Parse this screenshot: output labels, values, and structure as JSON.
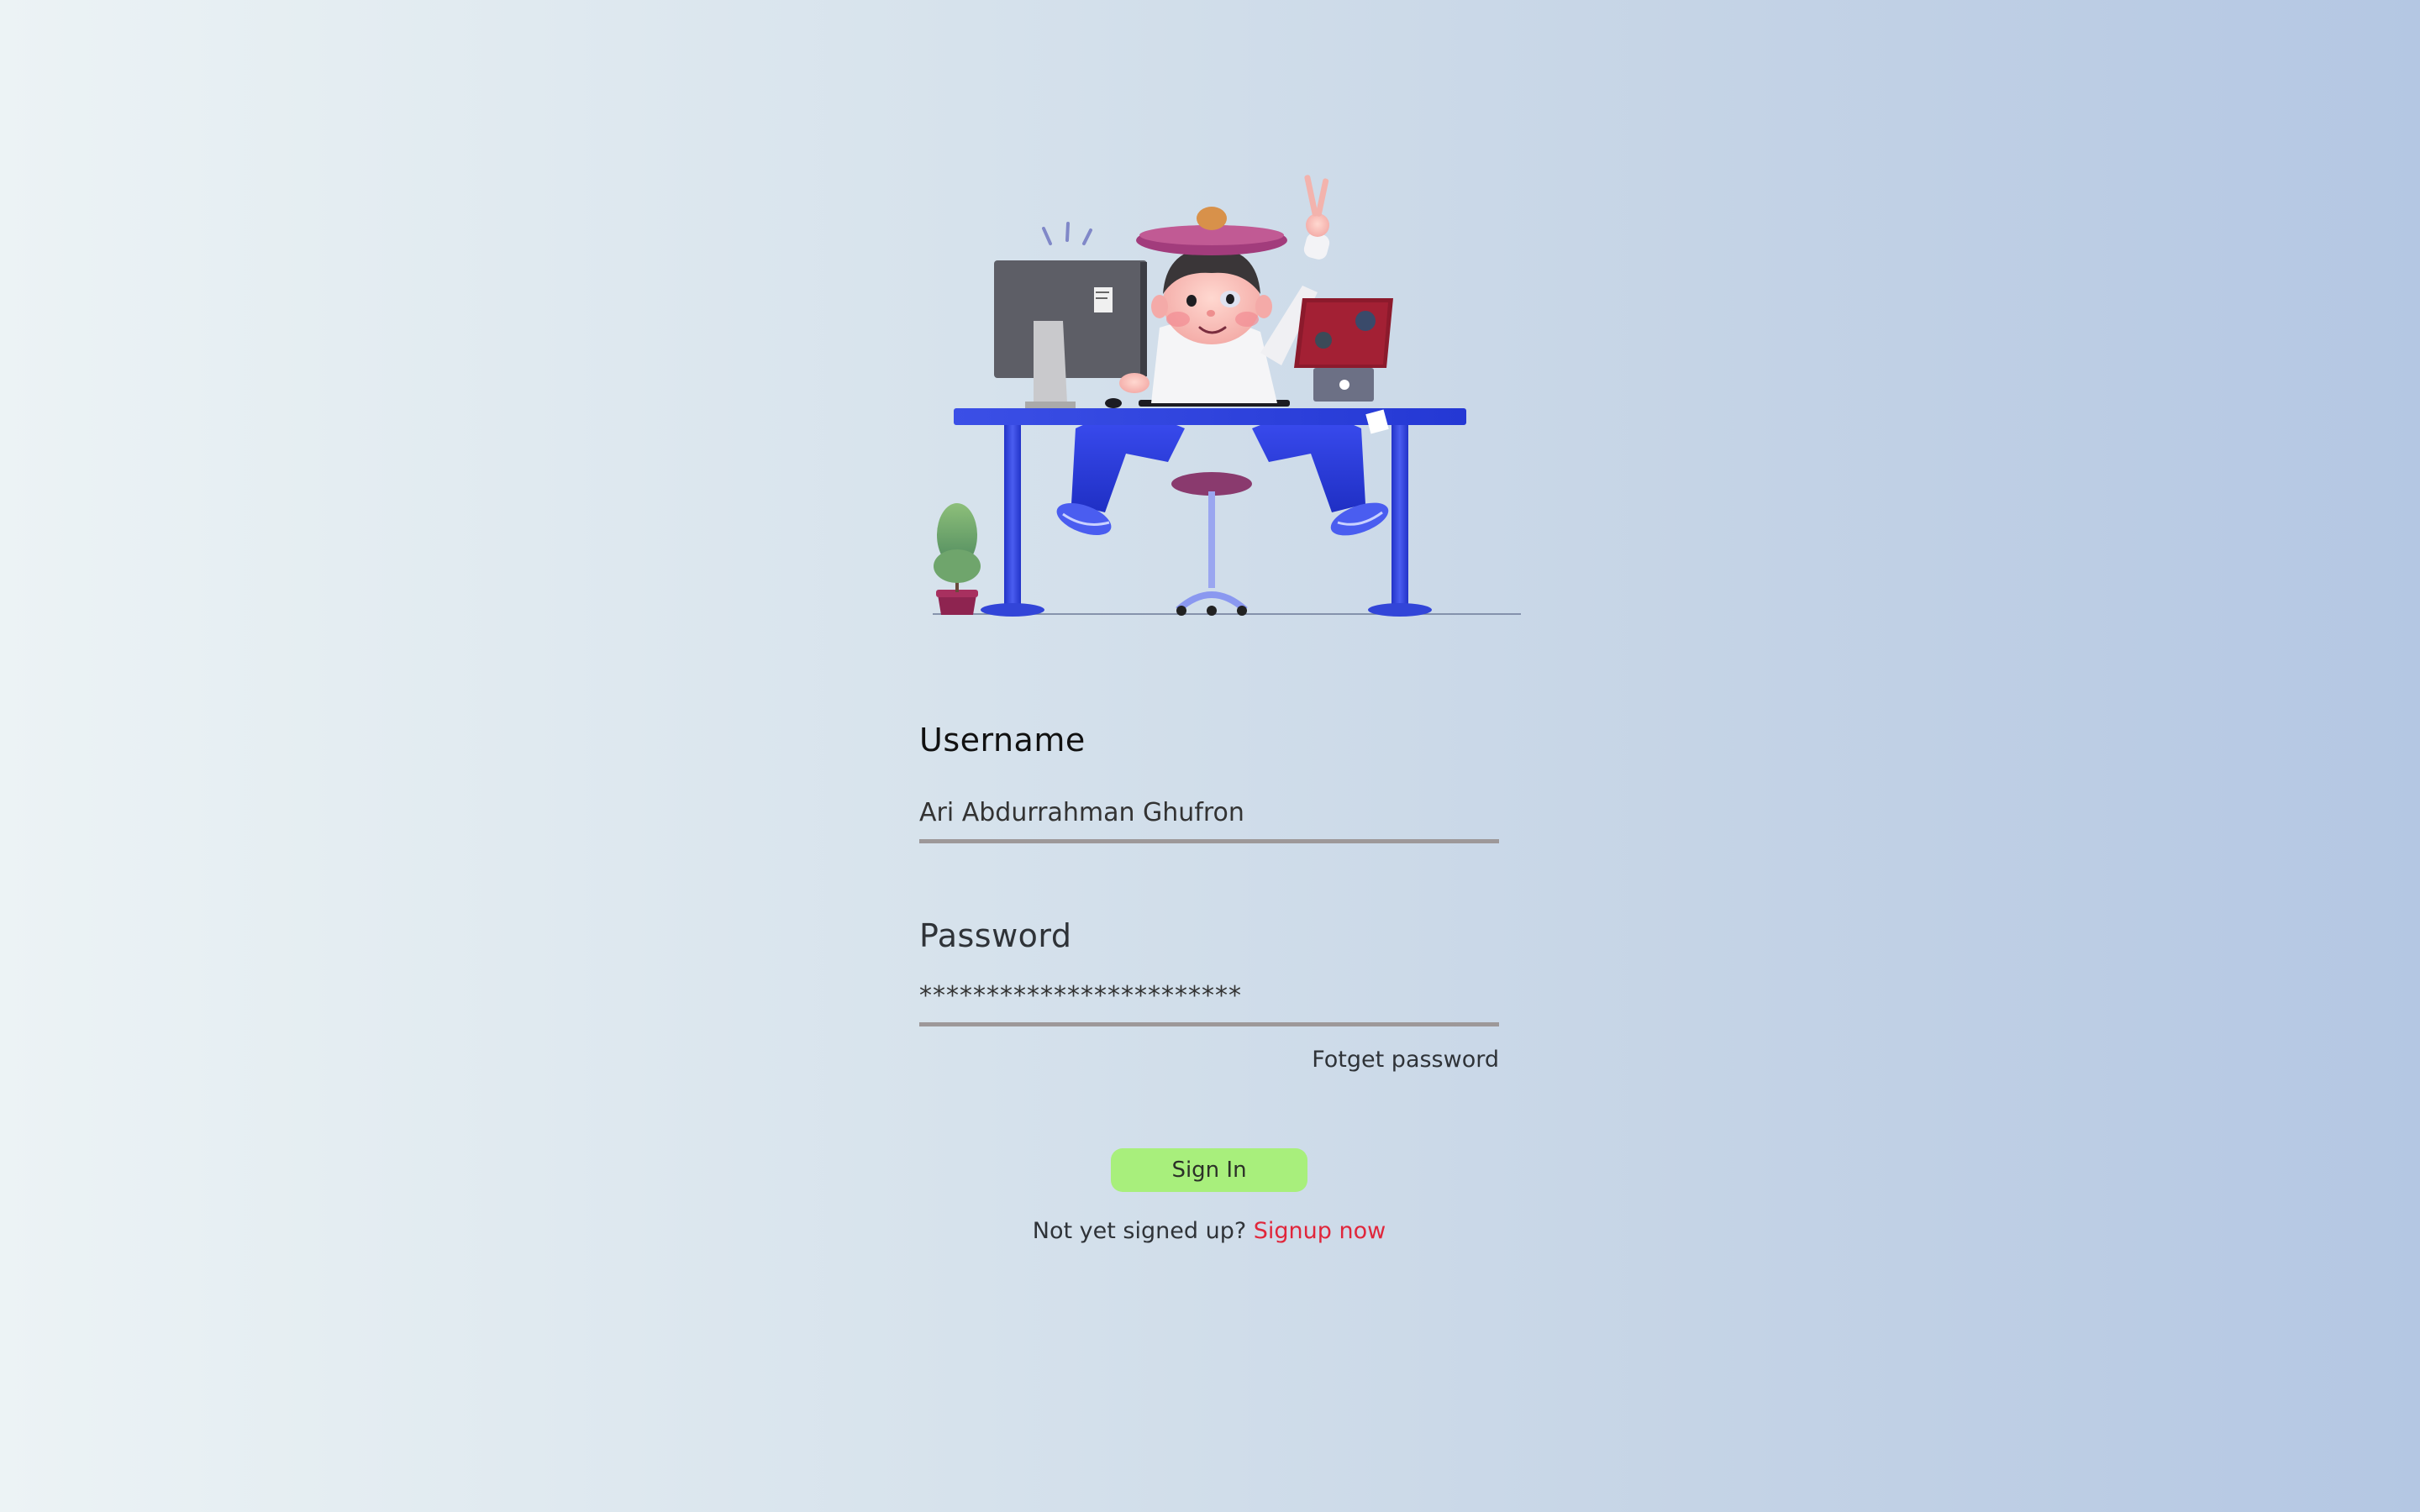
{
  "illustration": {
    "alt": "3D character at desk with computer and laptop"
  },
  "form": {
    "username_label": "Username",
    "username_value": "Ari Abdurrahman Ghufron",
    "password_label": "Password",
    "password_value": "************************",
    "forgot_label": "Fotget password",
    "signin_label": "Sign In",
    "signup_prompt": "Not yet signed up?",
    "signup_link": "Signup now"
  },
  "colors": {
    "background_left": "#ecf3f5",
    "background_right": "#b4c7e3",
    "signin_button": "#a8ef7c",
    "signup_link": "#e0263b",
    "input_underline": "#9d9899",
    "desk": "#2f43e0"
  }
}
